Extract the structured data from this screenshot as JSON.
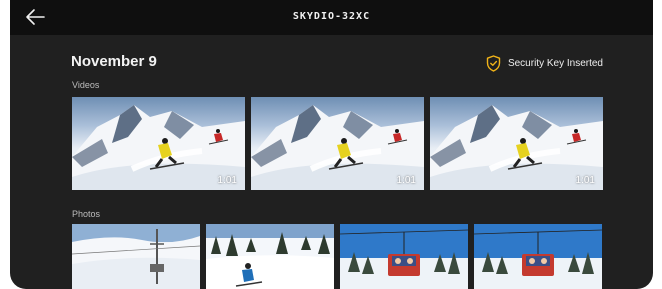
{
  "header": {
    "title": "SKYDIO-32XC",
    "back_icon": "back-arrow-icon"
  },
  "gallery": {
    "date": "November 9",
    "security_status": "Security Key Inserted",
    "security_icon": "shield-check-icon",
    "accent_color": "#f2b418"
  },
  "videos": {
    "label": "Videos",
    "items": [
      {
        "duration": "1:01"
      },
      {
        "duration": "1:01"
      },
      {
        "duration": "1:01"
      }
    ]
  },
  "photos": {
    "label": "Photos",
    "count_visible": 4
  }
}
